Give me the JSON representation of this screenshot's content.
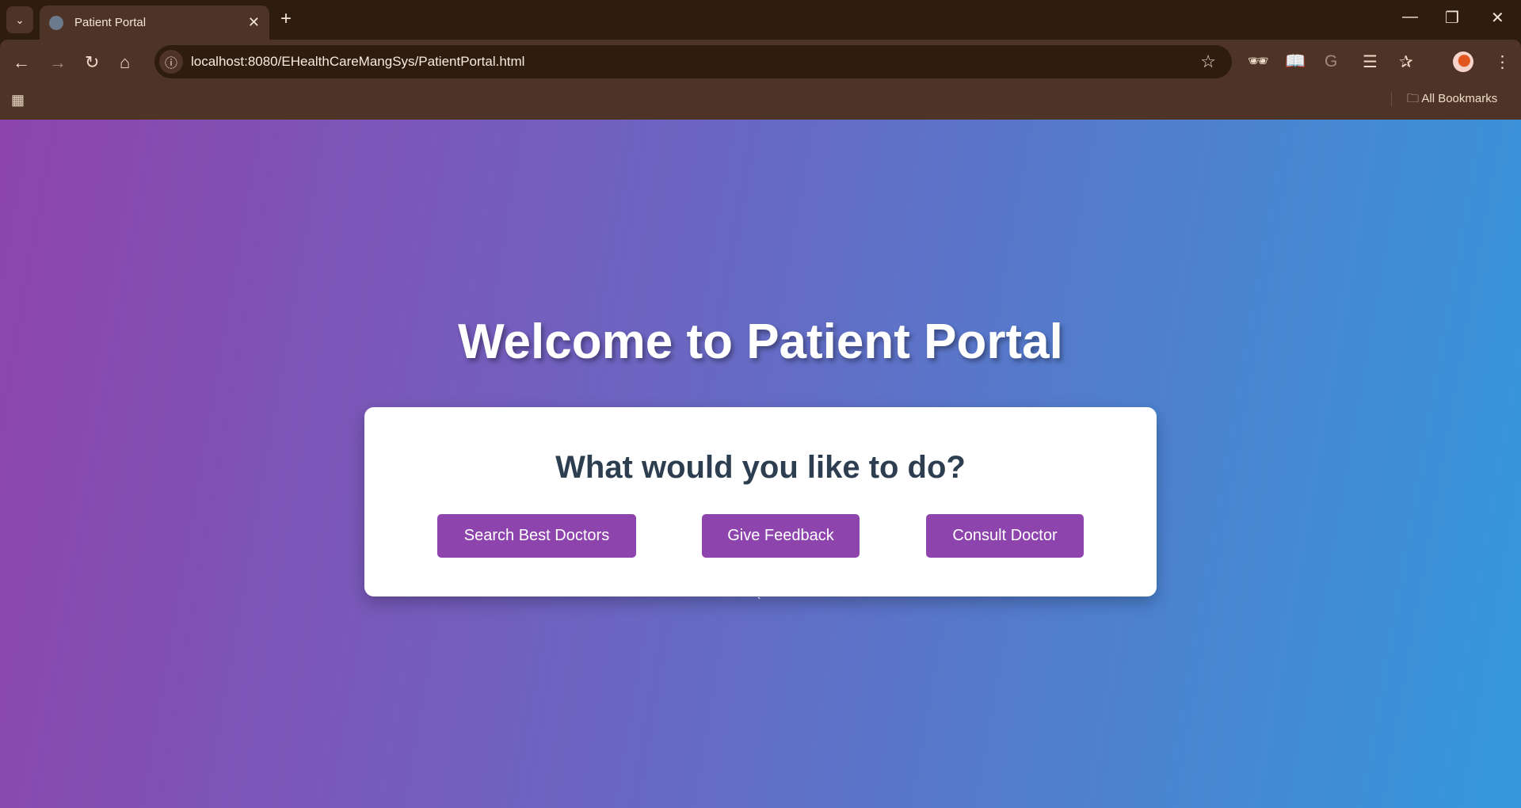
{
  "browser": {
    "tab_title": "Patient Portal",
    "url": "localhost:8080/EHealthCareMangSys/PatientPortal.html",
    "bookmarks_label": "All Bookmarks",
    "icons": {
      "menu": "⌄",
      "close": "✕",
      "new_tab": "+",
      "minimize": "—",
      "restore": "❐",
      "window_close": "✕",
      "back": "←",
      "forward": "→",
      "reload": "↻",
      "home": "⌂",
      "info": "ⓘ",
      "star": "☆",
      "incognito": "🕶",
      "reader": "📖",
      "translate": "G",
      "reading_list": "☰",
      "favorites": "✰",
      "more": "⋮",
      "apps": "▦",
      "folder": "🗀"
    }
  },
  "page": {
    "title": "Welcome to Patient Portal",
    "prompt": "What would you like to do?",
    "buttons": [
      "Search Best Doctors",
      "Give Feedback",
      "Consult Doctor"
    ],
    "stray_text": "`"
  },
  "colors": {
    "button": "#8e44ad",
    "heading": "#2c3e50",
    "gradient_start": "#8e44ad",
    "gradient_end": "#3498db"
  }
}
